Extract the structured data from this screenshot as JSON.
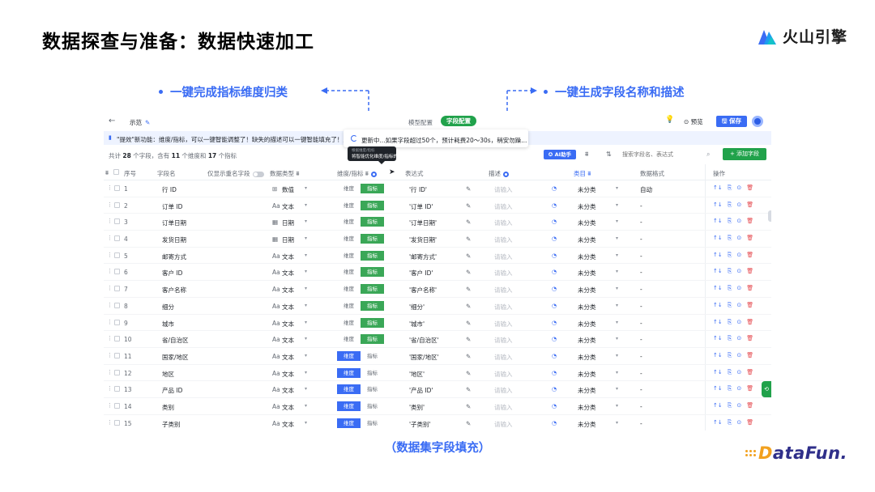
{
  "slide": {
    "title": "数据探查与准备：数据快速加工",
    "brand": "火山引擎",
    "callout_left": "一键完成指标维度归类",
    "callout_right": "一键生成字段名称和描述",
    "caption": "（数据集字段填充）",
    "datafun": {
      "lead": "D",
      "rest": "ataFun."
    },
    "colors": {
      "accent": "#3a6cf4",
      "metric_green": "#3aa757",
      "dimension_blue": "#3a6cf4",
      "brand_orange": "#f2a11f"
    }
  },
  "app": {
    "back_icon": "←",
    "name": "示范",
    "edit_icon": "✎",
    "tabs": {
      "model": "模型配置",
      "field": "字段配置"
    },
    "bulb_icon": "💡",
    "preview": "⊙ 预览",
    "save": "🖫 保存",
    "notice_icon": "▮",
    "notice": "\"提效\"新功能：维度/指标，可以一键智能调整了！缺失的描述可以一键智能填充了！点击",
    "updating": "更新中...如果字段超过50个，预计耗费20～30s，稍安勿躁...",
    "tooltip_title": "根据维度/指标",
    "tooltip_text": "将智能优化维度/指标的类型",
    "cursor_icon": "➤",
    "summary": {
      "p1": "共计 ",
      "total": "28",
      "p2": " 个字段，含有 ",
      "dims": "11",
      "p3": " 个维度和 ",
      "metrics": "17",
      "p4": " 个指标"
    },
    "ai_helper": "✪ AI助手",
    "filter_icon_1": "⩩",
    "sort_icon": "⇅",
    "search_placeholder": "搜索字段名、表达式",
    "search_icon": "⌕",
    "add_field": "+ 添加字段"
  },
  "table": {
    "headers": {
      "filter": "⩩",
      "index": "序号",
      "name": "字段名",
      "only_renamed": "仅显示重名字段",
      "data_type": "数据类型",
      "data_type_filter": "⩩",
      "role": "维度/指标",
      "role_filter": "⩩",
      "expression": "表达式",
      "description": "描述",
      "category": "类目",
      "category_filter": "⩩",
      "format": "数据格式",
      "actions": "操作"
    },
    "role_labels": {
      "dimension": "维度",
      "metric": "指标"
    },
    "desc_placeholder": "请输入",
    "category_value": "未分类",
    "rows": [
      {
        "index": "1",
        "name": "行 ID",
        "type_icon": "⊞",
        "type": "数值",
        "role": "metric",
        "expr": "'行 ID'",
        "format": "自动"
      },
      {
        "index": "2",
        "name": "订单 ID",
        "type_icon": "Aa",
        "type": "文本",
        "role": "metric",
        "expr": "'订单 ID'",
        "format": "-"
      },
      {
        "index": "3",
        "name": "订单日期",
        "type_icon": "▦",
        "type": "日期",
        "role": "metric",
        "expr": "'订单日期'",
        "format": "-"
      },
      {
        "index": "4",
        "name": "发货日期",
        "type_icon": "▦",
        "type": "日期",
        "role": "metric",
        "expr": "'发货日期'",
        "format": "-"
      },
      {
        "index": "5",
        "name": "邮寄方式",
        "type_icon": "Aa",
        "type": "文本",
        "role": "metric",
        "expr": "'邮寄方式'",
        "format": "-"
      },
      {
        "index": "6",
        "name": "客户 ID",
        "type_icon": "Aa",
        "type": "文本",
        "role": "metric",
        "expr": "'客户 ID'",
        "format": "-"
      },
      {
        "index": "7",
        "name": "客户名称",
        "type_icon": "Aa",
        "type": "文本",
        "role": "metric",
        "expr": "'客户名称'",
        "format": "-"
      },
      {
        "index": "8",
        "name": "细分",
        "type_icon": "Aa",
        "type": "文本",
        "role": "metric",
        "expr": "'细分'",
        "format": "-"
      },
      {
        "index": "9",
        "name": "城市",
        "type_icon": "Aa",
        "type": "文本",
        "role": "metric",
        "expr": "'城市'",
        "format": "-"
      },
      {
        "index": "10",
        "name": "省/自治区",
        "type_icon": "Aa",
        "type": "文本",
        "role": "metric",
        "expr": "'省/自治区'",
        "format": "-"
      },
      {
        "index": "11",
        "name": "国家/地区",
        "type_icon": "Aa",
        "type": "文本",
        "role": "dimension",
        "expr": "'国家/地区'",
        "format": "-"
      },
      {
        "index": "12",
        "name": "地区",
        "type_icon": "Aa",
        "type": "文本",
        "role": "dimension",
        "expr": "'地区'",
        "format": "-"
      },
      {
        "index": "13",
        "name": "产品 ID",
        "type_icon": "Aa",
        "type": "文本",
        "role": "dimension",
        "expr": "'产品 ID'",
        "format": "-"
      },
      {
        "index": "14",
        "name": "类别",
        "type_icon": "Aa",
        "type": "文本",
        "role": "dimension",
        "expr": "'类别'",
        "format": "-"
      },
      {
        "index": "15",
        "name": "子类别",
        "type_icon": "Aa",
        "type": "文本",
        "role": "dimension",
        "expr": "'子类别'",
        "format": "-"
      }
    ],
    "icons": {
      "handle": "⋮",
      "caret": "▾",
      "edit": "✎",
      "category": "◔",
      "op_up": "↑↓",
      "op_doc": "⎘",
      "op_eye": "⊙",
      "op_delete": "🗑",
      "side_tab": "⟲"
    }
  }
}
